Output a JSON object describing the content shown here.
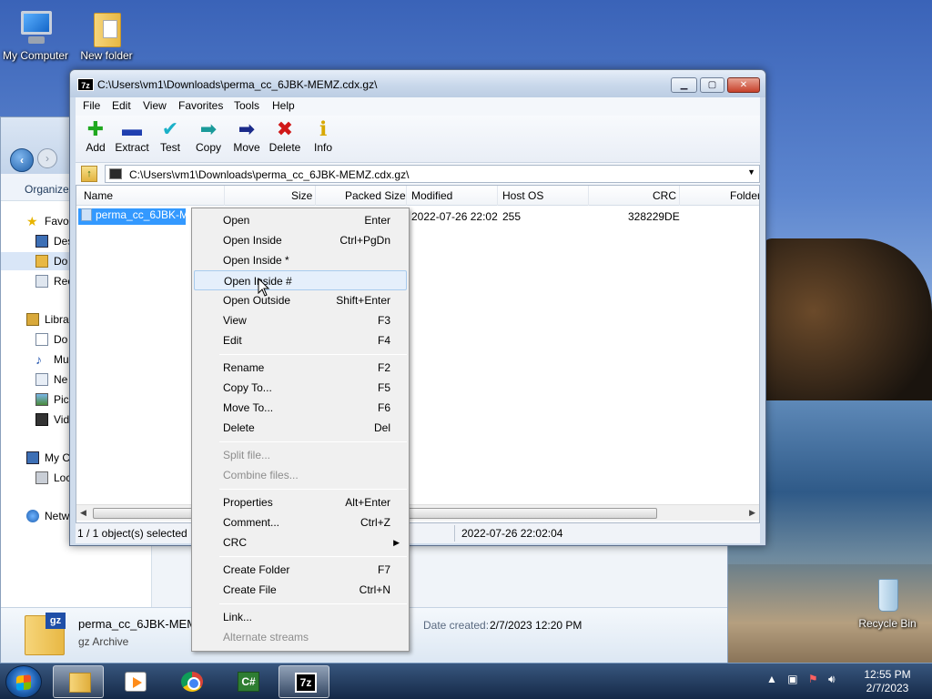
{
  "desktop": {
    "icons": [
      {
        "label": "My Computer",
        "icon": "computer-icon"
      },
      {
        "label": "New folder",
        "icon": "folder-icon"
      },
      {
        "label": "Recycle Bin",
        "icon": "recycle-bin-icon"
      }
    ]
  },
  "explorer": {
    "organize_label": "Organize",
    "sidebar": {
      "favorites": "Favo",
      "desktop": "Des",
      "downloads": "Do",
      "recent": "Rec",
      "libraries": "Libra",
      "documents": "Do",
      "music": "Mu",
      "new": "Ne",
      "pictures": "Pic",
      "videos": "Vid",
      "my_computer": "My C",
      "local": "Loc",
      "network": "Netw"
    },
    "details": {
      "filename": "perma_cc_6JBK-MEMZ",
      "type": "gz Archive",
      "date_created_label": "Date created:",
      "date_created_value": "2/7/2023 12:20 PM",
      "gz_tag": "gz"
    }
  },
  "window7z": {
    "app_icon_text": "7z",
    "title": "C:\\Users\\vm1\\Downloads\\perma_cc_6JBK-MEMZ.cdx.gz\\",
    "menu": [
      "File",
      "Edit",
      "View",
      "Favorites",
      "Tools",
      "Help"
    ],
    "toolbar": [
      {
        "label": "Add",
        "icon": "plus-icon",
        "glyph": "✚",
        "color": "#1fa81f"
      },
      {
        "label": "Extract",
        "icon": "minus-icon",
        "glyph": "▬",
        "color": "#1f3fb0"
      },
      {
        "label": "Test",
        "icon": "check-icon",
        "glyph": "✔",
        "color": "#1ab0c8"
      },
      {
        "label": "Copy",
        "icon": "copy-arrow-icon",
        "glyph": "➡",
        "color": "#1a9a9a"
      },
      {
        "label": "Move",
        "icon": "move-arrow-icon",
        "glyph": "➡",
        "color": "#1a2a8a"
      },
      {
        "label": "Delete",
        "icon": "delete-x-icon",
        "glyph": "✖",
        "color": "#d01818"
      },
      {
        "label": "Info",
        "icon": "info-icon",
        "glyph": "ℹ",
        "color": "#d8a800"
      }
    ],
    "address": "C:\\Users\\vm1\\Downloads\\perma_cc_6JBK-MEMZ.cdx.gz\\",
    "columns": [
      "Name",
      "Size",
      "Packed Size",
      "Modified",
      "Host OS",
      "CRC",
      "Folder"
    ],
    "row": {
      "name": "perma_cc_6JBK-MEMZ.cdx",
      "modified": "2022-07-26 22:02",
      "host_os": "255",
      "crc": "328229DE"
    },
    "status": {
      "selected": "1 / 1 object(s) selected",
      "modified": "2022-07-26 22:02:04"
    }
  },
  "context_menu": {
    "items": [
      {
        "label": "Open",
        "key": "Enter"
      },
      {
        "label": "Open Inside",
        "key": "Ctrl+PgDn"
      },
      {
        "label": "Open Inside *",
        "key": ""
      },
      {
        "label": "Open Inside #",
        "key": ""
      },
      {
        "label": "Open Outside",
        "key": "Shift+Enter"
      },
      {
        "label": "View",
        "key": "F3"
      },
      {
        "label": "Edit",
        "key": "F4"
      },
      {
        "label": "Rename",
        "key": "F2"
      },
      {
        "label": "Copy To...",
        "key": "F5"
      },
      {
        "label": "Move To...",
        "key": "F6"
      },
      {
        "label": "Delete",
        "key": "Del"
      },
      {
        "label": "Split file...",
        "key": ""
      },
      {
        "label": "Combine files...",
        "key": ""
      },
      {
        "label": "Properties",
        "key": "Alt+Enter"
      },
      {
        "label": "Comment...",
        "key": "Ctrl+Z"
      },
      {
        "label": "CRC",
        "key": ""
      },
      {
        "label": "Create Folder",
        "key": "F7"
      },
      {
        "label": "Create File",
        "key": "Ctrl+N"
      },
      {
        "label": "Link...",
        "key": ""
      },
      {
        "label": "Alternate streams",
        "key": ""
      }
    ]
  },
  "taskbar": {
    "apps": [
      "explorer",
      "media-player",
      "chrome",
      "csharp",
      "7zip"
    ],
    "csharp_text": "C#",
    "sevenzip_text": "7z",
    "clock_time": "12:55 PM",
    "clock_date": "2/7/2023"
  }
}
